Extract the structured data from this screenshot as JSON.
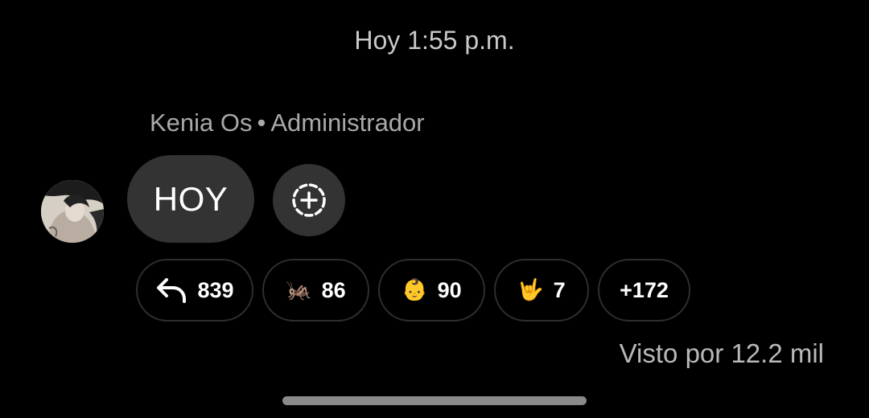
{
  "timestamp": "Hoy 1:55 p.m.",
  "sender": {
    "name": "Kenia Os",
    "separator": "•",
    "role": "Administrador"
  },
  "message": {
    "text": "HOY"
  },
  "add_reaction_icon": "dashed-circle-plus-icon",
  "reactions": [
    {
      "icon": "reply-arrow-icon",
      "count": "839"
    },
    {
      "icon": "cricket-icon",
      "emoji": "🦗",
      "count": "86"
    },
    {
      "icon": "baby-face-icon",
      "emoji": "👶",
      "count": "90"
    },
    {
      "icon": "love-you-gesture-icon",
      "emoji": "🤟",
      "count": "7"
    },
    {
      "label": "+172"
    }
  ],
  "seen_by": "Visto por 12.2 mil"
}
